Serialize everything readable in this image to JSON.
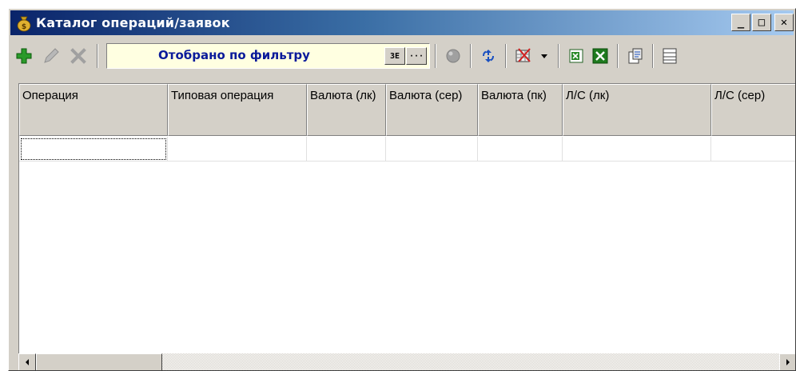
{
  "window": {
    "title": "Каталог операций/заявок",
    "icon": "money-bag-icon",
    "controls": {
      "minimize": "_",
      "maximize": "□",
      "close": "✕"
    }
  },
  "toolbar": {
    "add_icon": "plus-icon",
    "edit_icon": "pencil-icon",
    "delete_icon": "x-delete-icon",
    "filter_text": "Отобрано по фильтру",
    "filter_btn1": "ЗЕ",
    "filter_btn2": "···",
    "record_icon": "circle-icon",
    "refresh_icon": "refresh-icon",
    "export_icon": "table-delete-icon",
    "excel_icon": "excel-icon",
    "excel2_icon": "excel-green-icon",
    "report_icon": "report-icon",
    "columns_icon": "columns-icon",
    "colors": {
      "add": "#2a9a2a",
      "filter_text": "#0a1a9a",
      "filter_bg": "#ffffe1",
      "title_start": "#0a246a",
      "title_end": "#a6caf0"
    }
  },
  "table": {
    "columns": [
      "Операция",
      "Типовая операция",
      "Валюта (лк)",
      "Валюта (сер)",
      "Валюта (пк)",
      "Л/С (лк)",
      "Л/С (сер)"
    ],
    "rows": [
      [
        "",
        "",
        "",
        "",
        "",
        "",
        ""
      ]
    ]
  }
}
